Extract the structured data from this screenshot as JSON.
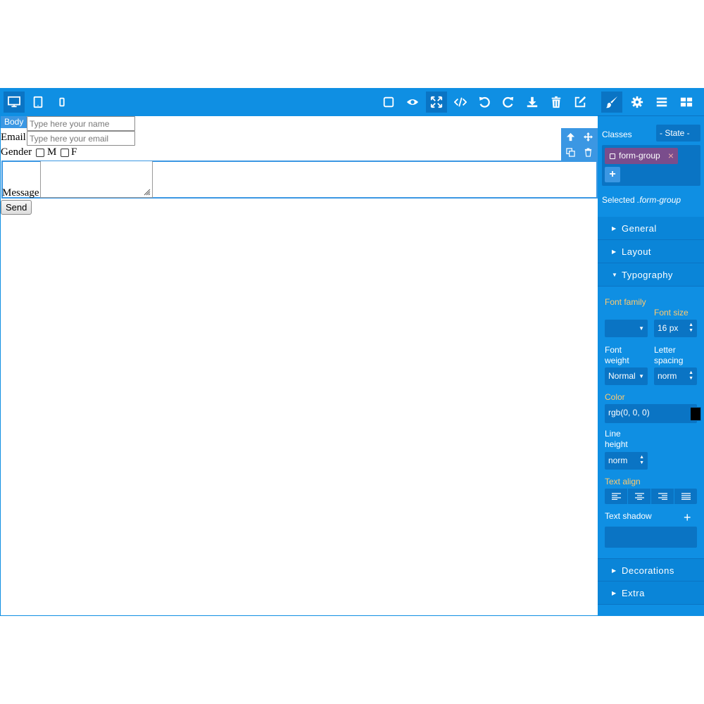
{
  "canvas": {
    "badge": "Body",
    "form": {
      "name_placeholder": "Type here your name",
      "email_label": "Email",
      "email_placeholder": "Type here your email",
      "gender_label": "Gender",
      "option_m": "M",
      "option_f": "F",
      "message_label": "Message",
      "send_label": "Send"
    }
  },
  "toolbar": {
    "devices": [
      "desktop-icon",
      "tablet-icon",
      "mobile-icon"
    ],
    "actions": [
      "sw-visibility-icon",
      "preview-icon",
      "fullscreen-icon",
      "code-icon",
      "undo-icon",
      "redo-icon",
      "import-icon",
      "trash-icon",
      "edit-icon"
    ]
  },
  "panel": {
    "classes_label": "Classes",
    "state_label": "- State -",
    "tag_label": "form-group",
    "tag_close": "×",
    "add_label": "+",
    "selected_prefix": "Selected",
    "selected_value": ".form-group",
    "sectors": {
      "general": "General",
      "layout": "Layout",
      "typography": "Typography",
      "decorations": "Decorations",
      "extra": "Extra"
    },
    "typography": {
      "font_family_label": "Font family",
      "font_family_value": "",
      "font_size_label": "Font size",
      "font_size_value": "16",
      "font_size_unit": "px",
      "font_weight_label": "Font weight",
      "font_weight_value": "Normal",
      "letter_spacing_label": "Letter spacing",
      "letter_spacing_value": "norm",
      "color_label": "Color",
      "color_value": "rgb(0, 0, 0)",
      "line_height_label": "Line height",
      "line_height_value": "norm",
      "text_align_label": "Text align",
      "text_shadow_label": "Text shadow",
      "text_shadow_add": "+"
    }
  },
  "colors": {
    "primary": "#0f8fe3",
    "primary_dark": "#0a74c4",
    "highlight": "#3b97e3",
    "label_orange": "#ffca6f",
    "tag_purple": "#7a4d8c"
  }
}
